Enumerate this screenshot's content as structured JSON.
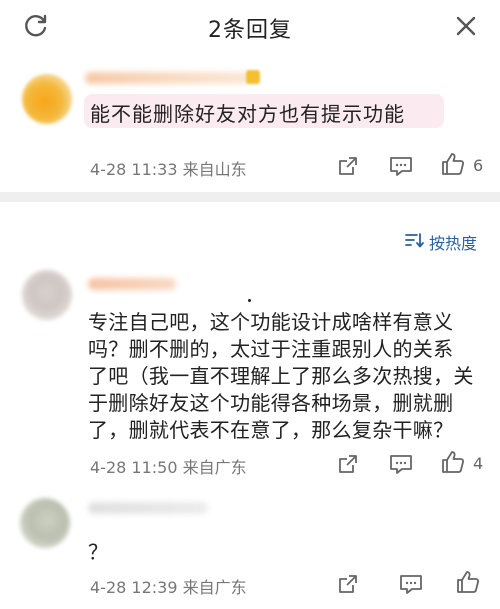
{
  "header": {
    "title": "2条回复",
    "refresh_icon": "refresh-icon",
    "close_icon": "close-icon"
  },
  "original_comment": {
    "text": "能不能删除好友对方也有提示功能",
    "time": "4-28 11:33",
    "location": "来自山东",
    "likes": "6",
    "icons": [
      "share-icon",
      "comment-icon",
      "like-icon"
    ]
  },
  "sort": {
    "label": "按热度",
    "icon": "sort-icon",
    "accent": "#2c5f9f"
  },
  "replies": [
    {
      "lines": [
        "专注自己吧，这个功能设计成啥样有意义",
        "吗？删不删的，太过于注重跟别人的关系",
        "了吧（我一直不理解上了那么多次热搜，关",
        "于删除好友这个功能得各种场景，删就删",
        "了，删就代表不在意了，那么复杂干嘛？"
      ],
      "time": "4-28 11:50",
      "location": "来自广东",
      "likes": "4"
    },
    {
      "lines": [
        "？"
      ],
      "time": "4-28 12:39",
      "location": "来自广东",
      "likes": ""
    }
  ],
  "colors": {
    "bubble_bg": "#fbeaf0",
    "meta_text": "#777777",
    "divider": "#efefef"
  }
}
